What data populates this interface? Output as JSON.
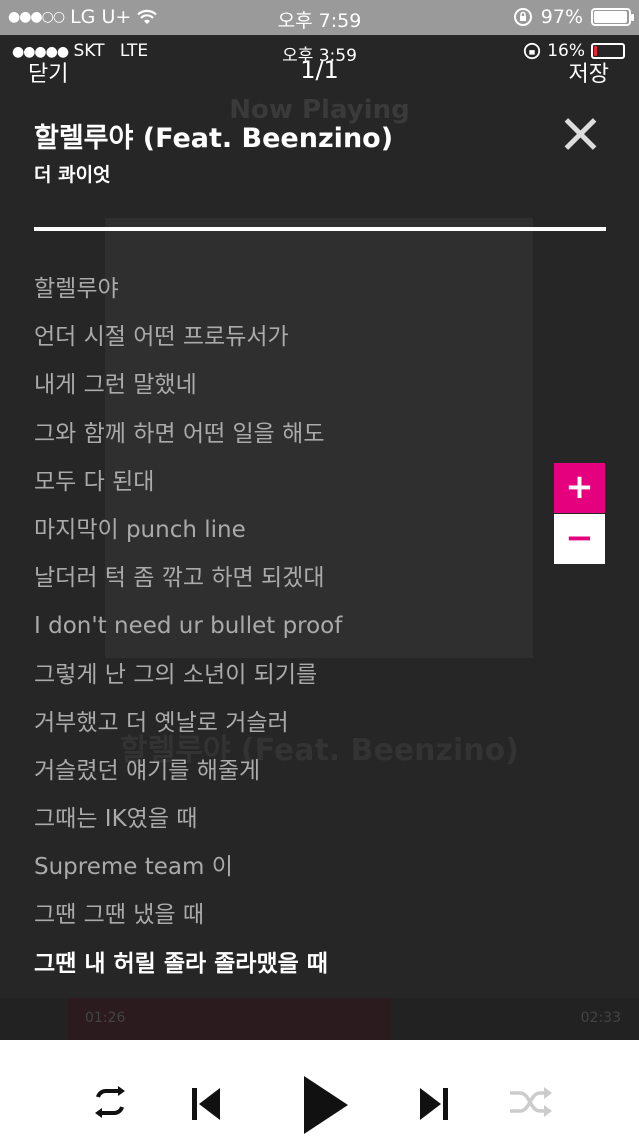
{
  "outer_status": {
    "signal_dots": "●●●○○",
    "carrier": "LG U+",
    "time": "오후 7:59",
    "battery_percent": "97%",
    "battery_level": 0.97
  },
  "inner_status": {
    "signal_dots": "●●●●●",
    "carrier": "SKT",
    "network": "LTE",
    "time": "오후 3:59",
    "battery_percent": "16%",
    "battery_level": 0.16
  },
  "background_screen": {
    "now_playing_label": "Now Playing",
    "ghost_title": "할렐루야 (Feat. Beenzino)",
    "elapsed": "01:26",
    "total": "02:33"
  },
  "header": {
    "close_label": "닫기",
    "page_indicator": "1/1",
    "save_label": "저장"
  },
  "song": {
    "title": "할렐루야 (Feat. Beenzino)",
    "artist": "더 콰이엇"
  },
  "lyrics": [
    "할렐루야",
    "언더 시절 어떤 프로듀서가",
    "내게 그런 말했네",
    "그와 함께 하면 어떤 일을 해도",
    "모두 다 된대",
    "마지막이 punch line",
    "날더러 턱 좀 깎고 하면 되겠대",
    "I don't need ur bullet proof",
    "그렇게 난 그의 소년이 되기를",
    "거부했고 더 옛날로 거슬러",
    "거슬렸던 얘기를 해줄게",
    "그때는 IK였을 때",
    "Supreme team 이",
    "그땐 그땐 냈을 때",
    "그땐 내 허릴 졸라 졸라맸을 때"
  ],
  "zoom": {
    "plus": "+",
    "minus": "−"
  },
  "icons": {
    "close": "close-x-icon",
    "repeat": "repeat-icon",
    "prev": "skip-previous-icon",
    "play": "play-icon",
    "next": "skip-next-icon",
    "shuffle": "shuffle-icon"
  },
  "colors": {
    "accent": "#e5007e",
    "overlay_bg": "#1b1b1b",
    "lyric_text": "#aaaaaa",
    "current_lyric": "#ffffff",
    "shuffle_disabled": "#cccccc"
  }
}
